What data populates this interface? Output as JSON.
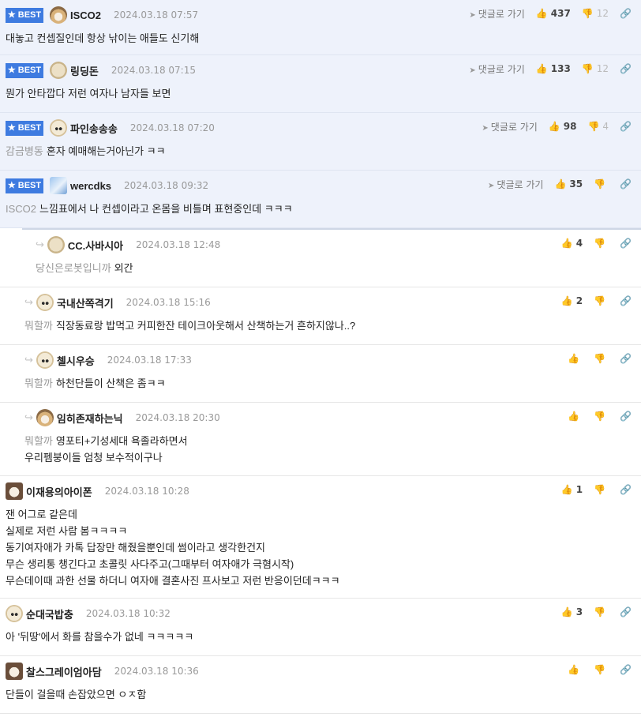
{
  "ui": {
    "best_label": "BEST",
    "reply_link_label": "댓글로 가기",
    "reply_arrow": "↪",
    "thumb_up_icon": "👍",
    "thumb_down_icon": "👎",
    "link_icon": "🔗"
  },
  "comments": [
    {
      "best": true,
      "depth": 0,
      "avatar": "fox",
      "nick": "ISCO2",
      "date": "2024.03.18 07:57",
      "mention": "",
      "lines": [
        "대놓고 컨셉질인데 항상 낚이는 애들도 신기해"
      ],
      "up": "437",
      "down": "12",
      "reply_link": true
    },
    {
      "best": true,
      "depth": 0,
      "avatar": "cream",
      "nick": "링딩돈",
      "date": "2024.03.18 07:15",
      "mention": "",
      "lines": [
        "뭔가 안타깝다 저런 여자나 남자들 보면"
      ],
      "up": "133",
      "down": "12",
      "reply_link": true
    },
    {
      "best": true,
      "depth": 0,
      "avatar": "dog",
      "nick": "파인송송송",
      "date": "2024.03.18 07:20",
      "mention": "감금병동",
      "lines": [
        "혼자 예매해는거아닌가 ㅋㅋ"
      ],
      "up": "98",
      "down": "4",
      "reply_link": true
    },
    {
      "best": true,
      "depth": 0,
      "avatar": "blue",
      "nick": "wercdks",
      "date": "2024.03.18 09:32",
      "mention": "ISCO2",
      "lines": [
        "느낌표에서 나 컨셉이라고 온몸을 비틀며 표현중인데 ㅋㅋㅋ"
      ],
      "up": "35",
      "down": "",
      "reply_link": true
    },
    {
      "best": false,
      "depth": 2,
      "avatar": "cream",
      "nick": "CC.사바시아",
      "date": "2024.03.18 12:48",
      "mention": "당신은로봇입니까",
      "lines": [
        "외간"
      ],
      "up": "4",
      "down": "",
      "reply_link": false
    },
    {
      "best": false,
      "depth": 1,
      "avatar": "dog",
      "nick": "국내산쪽격기",
      "date": "2024.03.18 15:16",
      "mention": "뭐할까",
      "lines": [
        "직장동료랑 밥먹고 커피한잔 테이크아웃해서 산책하는거 흔하지않나..?"
      ],
      "up": "2",
      "down": "",
      "reply_link": false
    },
    {
      "best": false,
      "depth": 1,
      "avatar": "dog",
      "nick": "첼시우승",
      "date": "2024.03.18 17:33",
      "mention": "뭐할까",
      "lines": [
        "하천단들이 산책은 좀ㅋㅋ"
      ],
      "up": "",
      "down": "",
      "reply_link": false
    },
    {
      "best": false,
      "depth": 1,
      "avatar": "fox",
      "nick": "임히존재하는닉",
      "date": "2024.03.18 20:30",
      "mention": "뭐할까",
      "lines": [
        "영포티+기성세대 욕졸라하면서",
        "우리펨붕이들 엄청 보수적이구나"
      ],
      "up": "",
      "down": "",
      "reply_link": false
    },
    {
      "best": false,
      "depth": 0,
      "avatar": "dark",
      "nick": "이재용의아이폰",
      "date": "2024.03.18 10:28",
      "mention": "",
      "lines": [
        "잰 어그로 같은데",
        "실제로 저런 사람 봄ㅋㅋㅋㅋ",
        "동기여자애가 카톡 답장만 해줬을뿐인데 썸이라고 생각한건지",
        "무슨 생리통 챙긴다고 초콜릿 사다주고(그때부터 여자애가 극혐시작)",
        "무슨데이때 과한 선물 하더니 여자애 결혼사진 프사보고 저런 반응이던데ㅋㅋㅋ"
      ],
      "up": "1",
      "down": "",
      "reply_link": false
    },
    {
      "best": false,
      "depth": 0,
      "avatar": "dog",
      "nick": "순대국밥충",
      "date": "2024.03.18 10:32",
      "mention": "",
      "lines": [
        "아 '뒤땅'에서 화를 참을수가 없네 ㅋㅋㅋㅋㅋ"
      ],
      "up": "3",
      "down": "",
      "reply_link": false
    },
    {
      "best": false,
      "depth": 0,
      "avatar": "dark",
      "nick": "찰스그레이엄아담",
      "date": "2024.03.18 10:36",
      "mention": "",
      "lines": [
        "단들이 걸을때 손잡았으면 ㅇㅈ함"
      ],
      "up": "",
      "down": "",
      "reply_link": false
    }
  ]
}
